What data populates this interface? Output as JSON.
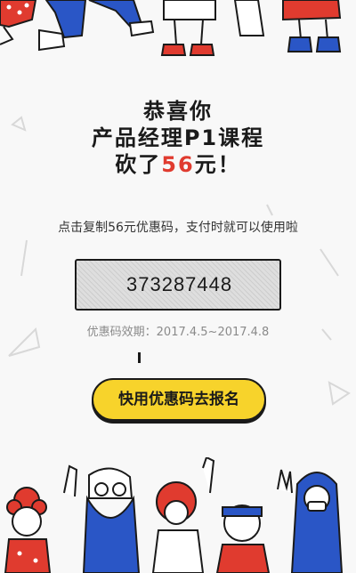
{
  "congrats": {
    "line1": "恭喜你",
    "line2": "产品经理P1课程",
    "line3_prefix": "砍了",
    "amount": "56",
    "line3_suffix": "元！"
  },
  "instruction": "点击复制56元优惠码，支付时就可以使用啦",
  "coupon": {
    "code": "373287448",
    "validity": "优惠码效期：2017.4.5~2017.4.8"
  },
  "cta_label": "快用优惠码去报名",
  "colors": {
    "accent_red": "#e03b2f",
    "button_yellow": "#f7d32b",
    "outline": "#1a1a1a",
    "blue": "#2a56c6"
  }
}
